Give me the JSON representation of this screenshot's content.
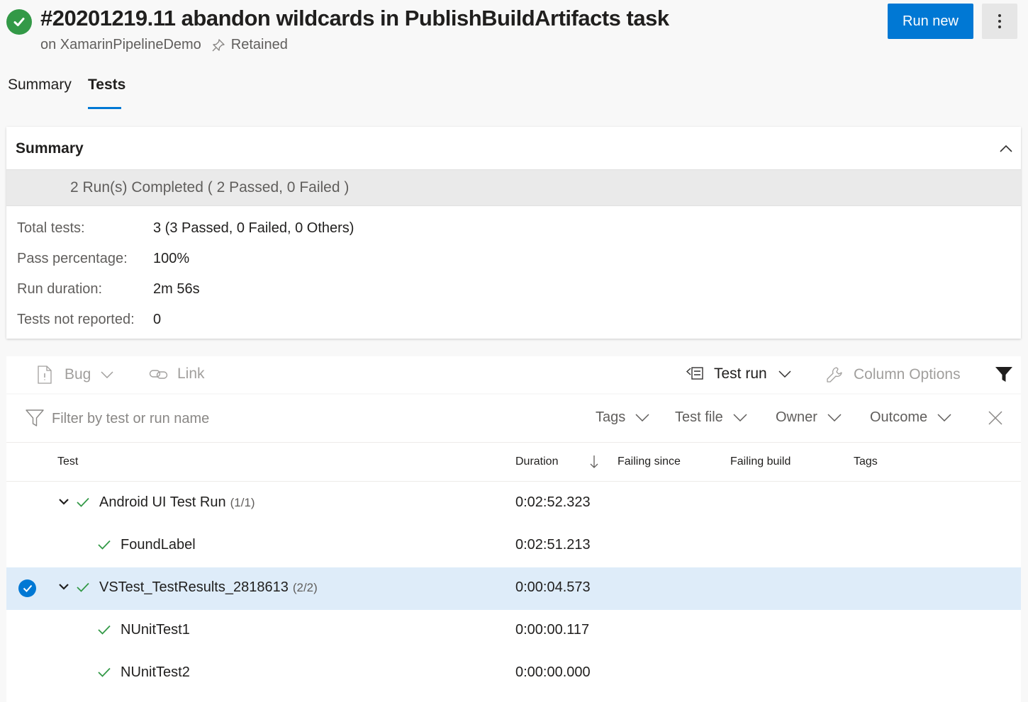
{
  "header": {
    "title": "#20201219.11 abandon wildcards in PublishBuildArtifacts task",
    "pipeline": "on XamarinPipelineDemo",
    "retained": "Retained",
    "run_new_label": "Run new"
  },
  "tabs": [
    {
      "label": "Summary",
      "active": false
    },
    {
      "label": "Tests",
      "active": true
    }
  ],
  "summary": {
    "title": "Summary",
    "runs_completed": "2 Run(s) Completed ( 2 Passed, 0 Failed )",
    "stats": [
      {
        "label": "Total tests:",
        "value": "3 (3 Passed, 0 Failed, 0 Others)"
      },
      {
        "label": "Pass percentage:",
        "value": "100%"
      },
      {
        "label": "Run duration:",
        "value": "2m 56s"
      },
      {
        "label": "Tests not reported:",
        "value": "0"
      }
    ]
  },
  "toolbar": {
    "bug_label": "Bug",
    "link_label": "Link",
    "test_run_label": "Test run",
    "column_options_label": "Column Options"
  },
  "filter": {
    "placeholder": "Filter by test or run name",
    "dropdowns": [
      "Tags",
      "Test file",
      "Owner",
      "Outcome"
    ]
  },
  "table": {
    "columns": [
      "Test",
      "Duration",
      "Failing since",
      "Failing build",
      "Tags"
    ],
    "rows": [
      {
        "name": "Android UI Test Run",
        "count": "(1/1)",
        "duration": "0:02:52.323",
        "level": 0,
        "selected": false
      },
      {
        "name": "FoundLabel",
        "count": "",
        "duration": "0:02:51.213",
        "level": 1,
        "selected": false
      },
      {
        "name": "VSTest_TestResults_2818613",
        "count": "(2/2)",
        "duration": "0:00:04.573",
        "level": 0,
        "selected": true
      },
      {
        "name": "NUnitTest1",
        "count": "",
        "duration": "0:00:00.117",
        "level": 1,
        "selected": false
      },
      {
        "name": "NUnitTest2",
        "count": "",
        "duration": "0:00:00.000",
        "level": 1,
        "selected": false
      }
    ]
  },
  "colors": {
    "accent": "#0078d4",
    "success": "#339947",
    "selected_row": "#deecf9"
  }
}
